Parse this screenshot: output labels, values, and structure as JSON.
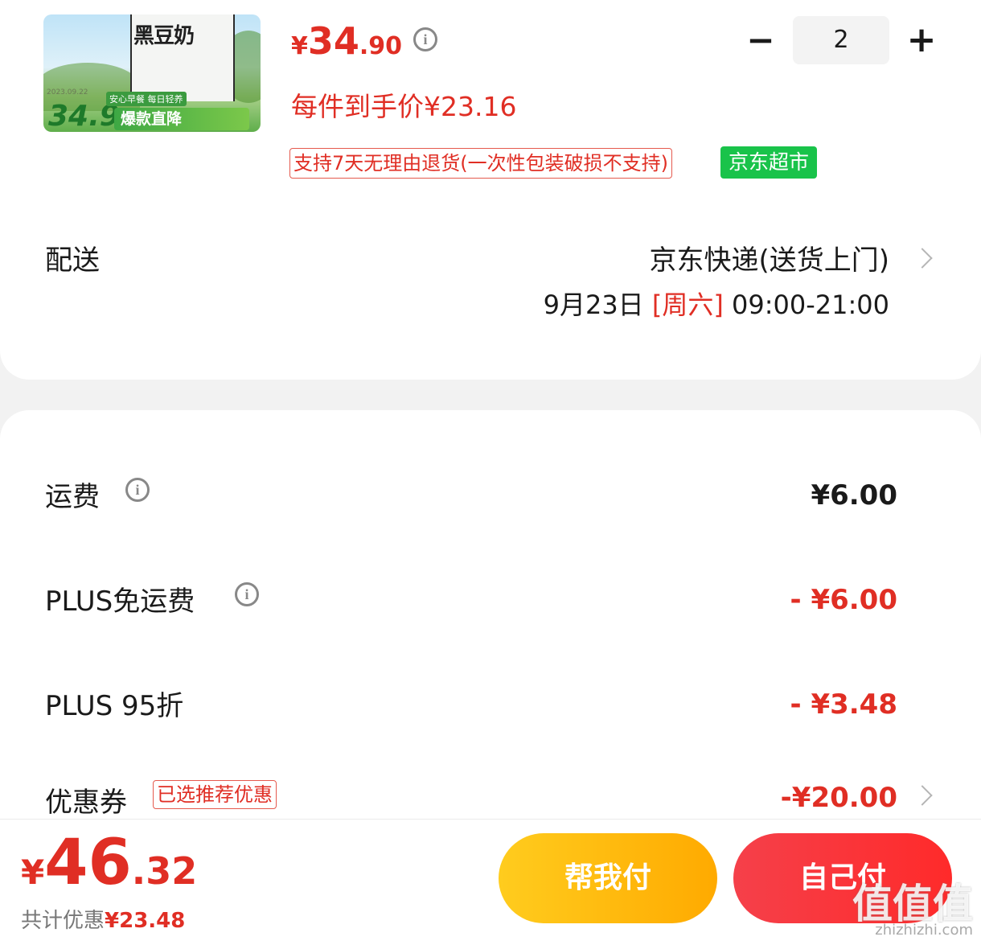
{
  "product": {
    "image_text": {
      "brand": "黑豆奶",
      "date": "2023.09.22",
      "promo_price": "34.9",
      "tag_small": "安心早餐 每日轻养",
      "tag_big": "爆款直降"
    },
    "price_yen": "¥",
    "price_int": "34",
    "price_dec": ".90",
    "per_item_price": "每件到手价¥23.16",
    "quantity": "2",
    "return_policy": "支持7天无理由退货(一次性包装破损不支持)",
    "store_tag": "京东超市",
    "colors": {
      "price_red": "#e02e24",
      "store_green": "#19c34a"
    }
  },
  "delivery": {
    "label": "配送",
    "method": "京东快递(送货上门)",
    "date": "9月23日",
    "weekday": "[周六]",
    "time": "09:00-21:00"
  },
  "fees": {
    "shipping_label": "运费",
    "shipping_value": "¥6.00",
    "plus_free_label": "PLUS免运费",
    "plus_free_value": "- ¥6.00",
    "plus_discount_label": "PLUS 95折",
    "plus_discount_value": "- ¥3.48",
    "coupon_label": "优惠券",
    "coupon_tag": "已选推荐优惠",
    "coupon_value": "-¥20.00"
  },
  "footer": {
    "total_yen": "¥",
    "total_int": "46",
    "total_dec": ".32",
    "saved_label": "共计优惠",
    "saved_amount": "¥23.48",
    "help_pay_label": "帮我付",
    "self_pay_label": "自己付",
    "watermark": "值值值",
    "watermark_url": "zhizhizhi.com"
  }
}
